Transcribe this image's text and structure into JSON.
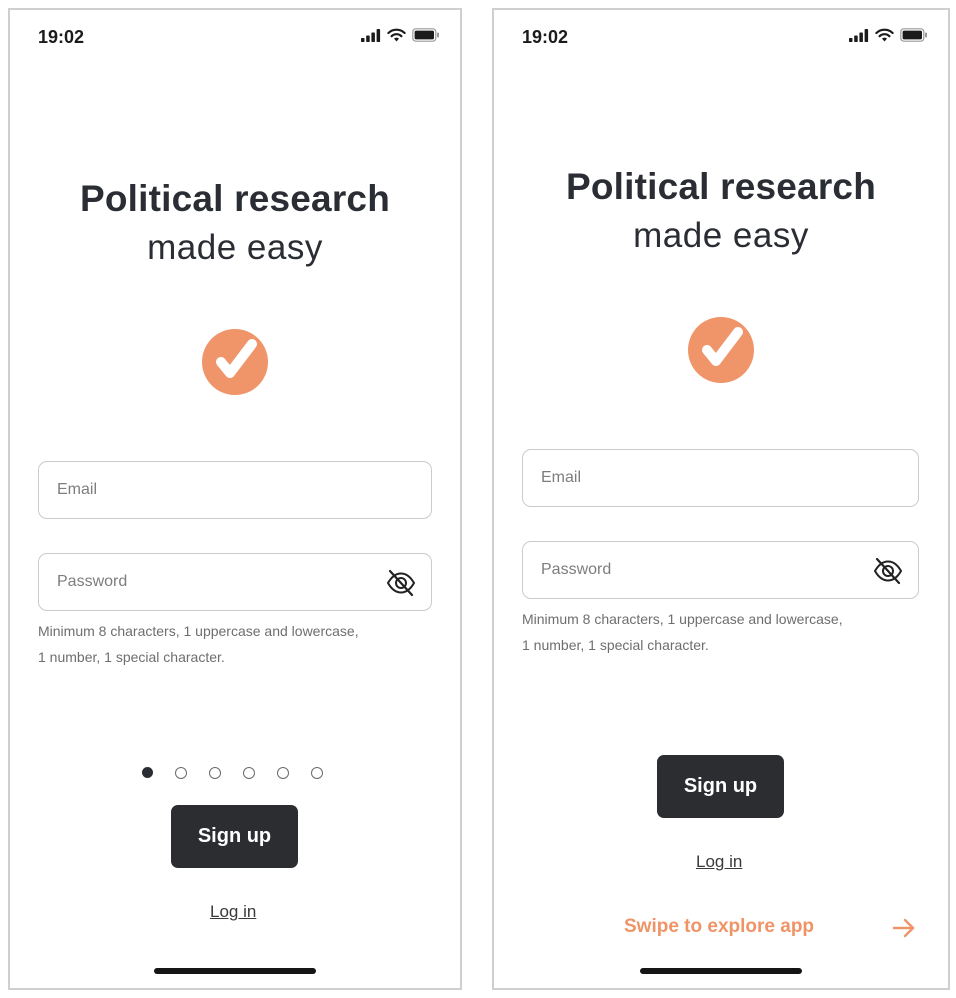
{
  "colors": {
    "accent": "#f0956a",
    "button_bg": "#2b2d31",
    "text_dark": "#2a2d33",
    "swipe_text": "#ef9467"
  },
  "screens": [
    {
      "status": {
        "time": "19:02",
        "icons": [
          "cellular-signal-icon",
          "wifi-icon",
          "battery-icon"
        ]
      },
      "headline": "Political research",
      "subheadline": "made easy",
      "logo_icon": "checkmark-logo-icon",
      "email": {
        "placeholder": "Email",
        "value": ""
      },
      "password": {
        "placeholder": "Password",
        "value": "",
        "toggle_icon": "eye-slash-icon"
      },
      "hint_line1": "Minimum 8 characters, 1 uppercase and lowercase,",
      "hint_line2": "1 number, 1 special character.",
      "pager": {
        "total": 6,
        "active": 1
      },
      "signup_label": "Sign up",
      "login_label": "Log in"
    },
    {
      "status": {
        "time": "19:02",
        "icons": [
          "cellular-signal-icon",
          "wifi-icon",
          "battery-icon"
        ]
      },
      "headline": "Political research",
      "subheadline": "made easy",
      "logo_icon": "checkmark-logo-icon",
      "email": {
        "placeholder": "Email",
        "value": ""
      },
      "password": {
        "placeholder": "Password",
        "value": "",
        "toggle_icon": "eye-slash-icon"
      },
      "hint_line1": "Minimum 8 characters, 1 uppercase and lowercase,",
      "hint_line2": "1 number, 1 special character.",
      "signup_label": "Sign up",
      "login_label": "Log in",
      "swipe_label": "Swipe to explore app",
      "swipe_icon": "arrow-right-icon"
    }
  ]
}
